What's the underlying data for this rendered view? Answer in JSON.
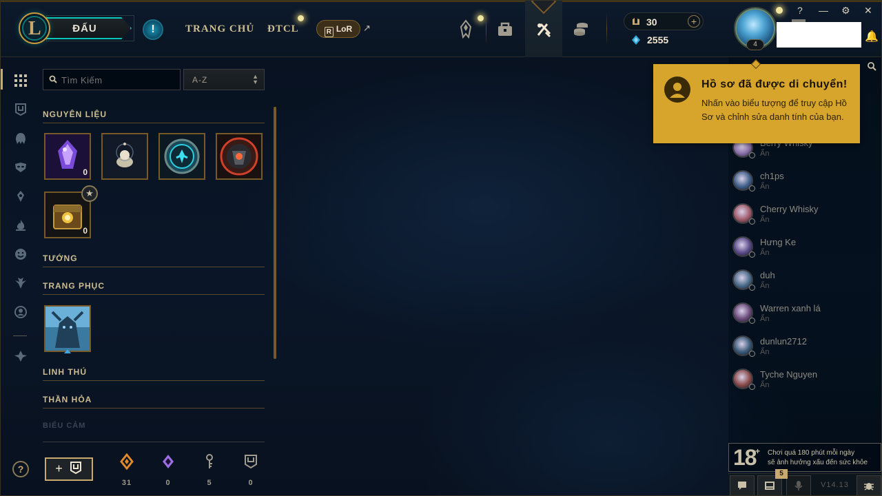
{
  "topbar": {
    "play_label": "ĐẤU",
    "alert_label": "!",
    "nav": [
      {
        "label": "TRANG CHỦ"
      },
      {
        "label": "ĐTCL"
      }
    ],
    "lor_label": "LoR",
    "lor_icon_text": "R",
    "external_glyph": "↗",
    "icons": [
      "collection-icon",
      "loot-icon",
      "store-icon",
      "currency-shop-icon"
    ],
    "rp_value": "30",
    "rp_plus": "+",
    "be_value": "2555",
    "level": "4",
    "window_controls": [
      "?",
      "—",
      "⚙",
      "✕"
    ]
  },
  "rail": {
    "icons": [
      "grid-icon",
      "crafting-icon",
      "champion-helmet-icon",
      "mask-icon",
      "ward-icon",
      "fire-icon",
      "emote-icon",
      "tft-icon",
      "profile-icon",
      "rank-icon"
    ],
    "help_label": "?"
  },
  "loot": {
    "search_placeholder": "Tìm Kiếm",
    "sort_label": "A-Z",
    "sections": {
      "materials": "NGUYÊN LIỆU",
      "champions": "TƯỚNG",
      "skins": "TRANG PHỤC",
      "companions": "LINH THÚ",
      "ward_skins": "THẦN HỎA",
      "faded": "BIỂU CẢM"
    },
    "materials": [
      {
        "name": "mythic-essence",
        "count": "0"
      },
      {
        "name": "orb",
        "count": ""
      },
      {
        "name": "key-token",
        "count": ""
      },
      {
        "name": "masterwork-chest",
        "count": ""
      },
      {
        "name": "hextech-chest",
        "count": "0"
      }
    ],
    "star_badge": "★",
    "craft_label": "+",
    "resources": [
      {
        "icon": "orange-essence-icon",
        "value": "31",
        "color": "#e08a2a"
      },
      {
        "icon": "mythic-essence-icon",
        "value": "0",
        "color": "#9b6fe0"
      },
      {
        "icon": "key-fragment-icon",
        "value": "5",
        "color": "#a09b8c"
      },
      {
        "icon": "chest-icon",
        "value": "0",
        "color": "#a09b8c"
      }
    ]
  },
  "toast": {
    "title": "Hồ sơ đã được di chuyển!",
    "body": "Nhấn vào biểu tượng để truy cập Hồ Sơ và chỉnh sửa danh tính của bạn."
  },
  "friends": [
    {
      "name": "Berry Whisky",
      "status": "Ẩn",
      "color": "#8a6fa8"
    },
    {
      "name": "ch1ps",
      "status": "Ẩn",
      "color": "#3f5f8a"
    },
    {
      "name": "Cherry Whisky",
      "status": "Ẩn",
      "color": "#a05a6a"
    },
    {
      "name": "Hưng Ke",
      "status": "Ẩn",
      "color": "#5a4a8a"
    },
    {
      "name": "duh",
      "status": "Ẩn",
      "color": "#4a6a8a"
    },
    {
      "name": "Warren xanh lá",
      "status": "Ẩn",
      "color": "#6a4a7a"
    },
    {
      "name": "dunlun2712",
      "status": "Ẩn",
      "color": "#3a5a7a"
    },
    {
      "name": "Tyche Nguyen",
      "status": "Ẩn",
      "color": "#8a4a4a"
    }
  ],
  "rating": {
    "age": "18",
    "plus": "+",
    "line1": "Chơi quá 180 phút mỗi ngày",
    "line2": "sẽ ảnh hưởng xấu đến sức khỏe"
  },
  "social": {
    "badge": "5",
    "version": "V14.13"
  },
  "colors": {
    "gold": "#c8aa6e",
    "teal": "#0ac8b9",
    "toast": "#d7a52b",
    "background": "#0a1428"
  }
}
